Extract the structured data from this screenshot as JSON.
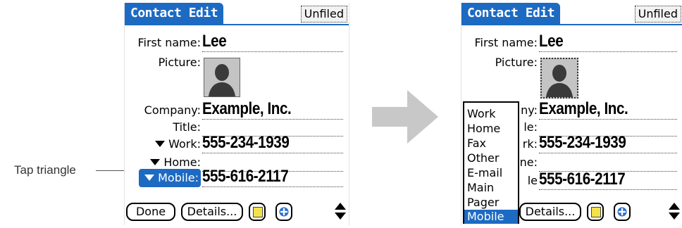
{
  "annotation": {
    "label": "Tap triangle"
  },
  "left_screen": {
    "title": "Contact Edit",
    "category": "Unfiled",
    "fields": {
      "first_name": {
        "label": "First name:",
        "value": "Lee"
      },
      "picture": {
        "label": "Picture:"
      },
      "company": {
        "label": "Company:",
        "value": "Example, Inc."
      },
      "title": {
        "label": "Title:",
        "value": ""
      },
      "work": {
        "label": "Work:",
        "value": "555-234-1939"
      },
      "home": {
        "label": "Home:",
        "value": ""
      },
      "mobile": {
        "label": "Mobile:",
        "value": "555-616-2117"
      }
    },
    "buttons": {
      "done": "Done",
      "details": "Details..."
    }
  },
  "right_screen": {
    "title": "Contact Edit",
    "category": "Unfiled",
    "fields": {
      "first_name": {
        "label": "First name:",
        "value": "Lee"
      },
      "picture": {
        "label": "Picture:"
      },
      "company": {
        "label_partial": "ny:",
        "value": "Example, Inc."
      },
      "title": {
        "label_partial": "le:",
        "value": ""
      },
      "work": {
        "label_partial": "rk:",
        "value": "555-234-1939"
      },
      "home": {
        "label_partial": "ne:",
        "value": ""
      },
      "mobile": {
        "label_partial": "le",
        "value": "555-616-2117"
      }
    },
    "popup": {
      "items": [
        "Work",
        "Home",
        "Fax",
        "Other",
        "E-mail",
        "Main",
        "Pager",
        "Mobile"
      ],
      "selected": "Mobile"
    },
    "buttons": {
      "details": "Details..."
    }
  },
  "colors": {
    "accent": "#1d6ac3",
    "note": "#f5e24a",
    "arrow": "#c8c8c8"
  },
  "icons": [
    "triangle-down-icon",
    "person-silhouette-icon",
    "note-icon",
    "plus-icon",
    "scroll-up-icon",
    "scroll-down-icon",
    "right-arrow-icon"
  ]
}
